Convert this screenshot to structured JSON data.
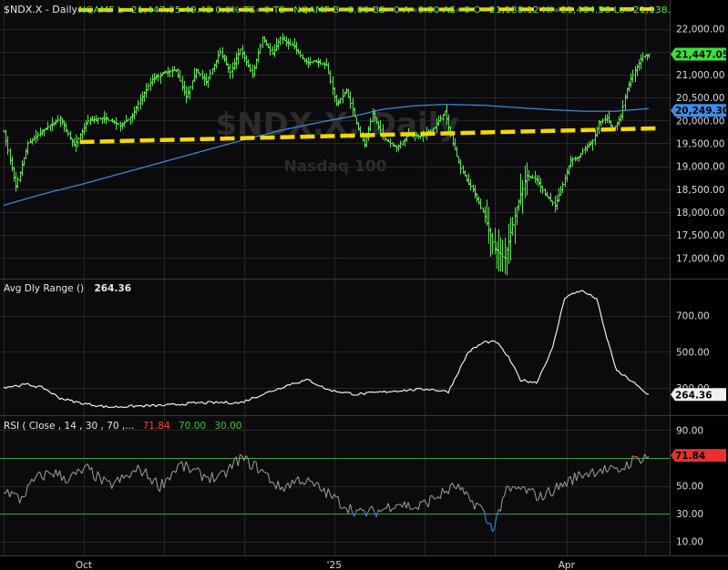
{
  "colors": {
    "background": "#000000",
    "panel_bg": "#0b0b0d",
    "grid": "#262628",
    "divider": "#3a3a3c",
    "bar_up": "#5de84a",
    "ma_line": "#3d8ee8",
    "trendline": "#f5d800",
    "range_line": "#ffffff",
    "rsi_line": "#a0a0a0",
    "rsi_low": "#3d8ee8",
    "rsi_high": "#ff5544",
    "rsi_level": "#36a636",
    "axis_text": "#dcdcdc",
    "price_badge": "#3de03a",
    "ma_badge": "#3d8ee8",
    "range_badge": "#f0f0f0",
    "rsi_badge": "#e83030",
    "watermark": "#3c3c3e"
  },
  "price_panel": {
    "header": "$NDX.X - Daily",
    "header_quote": "NQAMF L=21,447.05 49.43 0.0% TS=0 TS=NQAMF B=0.00 BS=0 A=0.00 AS=0 O=21,138.12 Hi=21,464.56 Lo=21,138.",
    "watermark_symbol": "$NDX.X, Daily",
    "watermark_name": "Nasdaq 100",
    "last_price_label": "21,447.05",
    "ma_label": "20,249.30"
  },
  "range_panel": {
    "title": "Avg Dly Range ()",
    "value": "264.36"
  },
  "rsi_panel": {
    "title": "RSI ( Close , 14 , 30 , 70 ,...",
    "val1": "71.84",
    "val2": "70.00",
    "val3": "30.00",
    "badge": "71.84"
  },
  "chart_data": [
    {
      "type": "bar",
      "subtype": "ohlc",
      "name": "$NDX.X - Daily",
      "y_ticks": [
        17000,
        17500,
        18000,
        18500,
        19000,
        19500,
        20000,
        20500,
        21000,
        21500,
        22000
      ],
      "y_tick_labels": [
        "17,000.00",
        "17,500.00",
        "18,000.00",
        "18,500.00",
        "19,000.00",
        "19,500.00",
        "20,000.00",
        "20,500.00",
        "21,000.00",
        "21,500.00",
        "22,000.00"
      ],
      "ylim": [
        16550,
        22350
      ],
      "x_tick_labels": [
        "Oct",
        "'25",
        "Apr"
      ],
      "close_anchors": [
        [
          0,
          19750
        ],
        [
          6,
          18550
        ],
        [
          12,
          19500
        ],
        [
          20,
          19800
        ],
        [
          28,
          20050
        ],
        [
          35,
          19450
        ],
        [
          42,
          20000
        ],
        [
          50,
          20050
        ],
        [
          58,
          19900
        ],
        [
          64,
          20100
        ],
        [
          68,
          20450
        ],
        [
          74,
          20900
        ],
        [
          80,
          21050
        ],
        [
          86,
          21100
        ],
        [
          91,
          20500
        ],
        [
          96,
          21100
        ],
        [
          101,
          20850
        ],
        [
          108,
          21500
        ],
        [
          113,
          21050
        ],
        [
          118,
          21550
        ],
        [
          124,
          21000
        ],
        [
          129,
          21800
        ],
        [
          134,
          21450
        ],
        [
          138,
          21800
        ],
        [
          145,
          21600
        ],
        [
          150,
          21300
        ],
        [
          152,
          21250
        ],
        [
          155,
          21300
        ],
        [
          161,
          21200
        ],
        [
          166,
          20350
        ],
        [
          171,
          20650
        ],
        [
          176,
          19950
        ],
        [
          180,
          19450
        ],
        [
          184,
          20150
        ],
        [
          190,
          19600
        ],
        [
          196,
          19400
        ],
        [
          202,
          19700
        ],
        [
          208,
          19650
        ],
        [
          215,
          19850
        ],
        [
          220,
          20200
        ],
        [
          224,
          19500
        ],
        [
          228,
          18950
        ],
        [
          235,
          18400
        ],
        [
          240,
          17900
        ],
        [
          245,
          17200
        ],
        [
          250,
          17000
        ],
        [
          256,
          18100
        ],
        [
          261,
          18800
        ],
        [
          266,
          18700
        ],
        [
          270,
          18400
        ],
        [
          275,
          18150
        ],
        [
          279,
          18600
        ],
        [
          283,
          19150
        ],
        [
          287,
          19200
        ],
        [
          290,
          19400
        ],
        [
          294,
          19550
        ],
        [
          297,
          19950
        ],
        [
          301,
          20050
        ],
        [
          304,
          19800
        ],
        [
          308,
          20100
        ],
        [
          311,
          20700
        ],
        [
          315,
          21100
        ],
        [
          319,
          21400
        ],
        [
          322,
          21447
        ]
      ],
      "ma_anchors": [
        [
          0,
          18150
        ],
        [
          20,
          18400
        ],
        [
          40,
          18620
        ],
        [
          60,
          18860
        ],
        [
          80,
          19100
        ],
        [
          100,
          19340
        ],
        [
          120,
          19580
        ],
        [
          140,
          19800
        ],
        [
          160,
          19980
        ],
        [
          175,
          20100
        ],
        [
          190,
          20250
        ],
        [
          205,
          20320
        ],
        [
          220,
          20350
        ],
        [
          240,
          20330
        ],
        [
          260,
          20270
        ],
        [
          275,
          20230
        ],
        [
          290,
          20200
        ],
        [
          305,
          20200
        ],
        [
          322,
          20260
        ]
      ],
      "trendline": [
        [
          38,
          19530
        ],
        [
          328,
          19830
        ]
      ]
    },
    {
      "type": "line",
      "name": "Avg Dly Range ()",
      "y_ticks": [
        300,
        500,
        700
      ],
      "y_tick_labels": [
        "300.00",
        "500.00",
        "700.00"
      ],
      "ylim": [
        150,
        900
      ],
      "anchors": [
        [
          0,
          305
        ],
        [
          12,
          320
        ],
        [
          20,
          300
        ],
        [
          28,
          245
        ],
        [
          38,
          218
        ],
        [
          52,
          195
        ],
        [
          66,
          200
        ],
        [
          82,
          205
        ],
        [
          96,
          218
        ],
        [
          110,
          220
        ],
        [
          118,
          218
        ],
        [
          128,
          260
        ],
        [
          144,
          325
        ],
        [
          152,
          345
        ],
        [
          162,
          290
        ],
        [
          176,
          265
        ],
        [
          196,
          285
        ],
        [
          212,
          295
        ],
        [
          222,
          280
        ],
        [
          232,
          500
        ],
        [
          240,
          555
        ],
        [
          246,
          555
        ],
        [
          252,
          470
        ],
        [
          258,
          345
        ],
        [
          266,
          330
        ],
        [
          274,
          520
        ],
        [
          280,
          800
        ],
        [
          288,
          840
        ],
        [
          296,
          795
        ],
        [
          300,
          620
        ],
        [
          306,
          395
        ],
        [
          314,
          335
        ],
        [
          320,
          275
        ],
        [
          322,
          264
        ]
      ]
    },
    {
      "type": "line",
      "name": "RSI ( Close , 14 , 30 , 70 ,...",
      "y_ticks": [
        10,
        30,
        50,
        70,
        90
      ],
      "y_tick_labels": [
        "10.00",
        "30.00",
        "50.00",
        "70.00",
        "90.00"
      ],
      "ylim": [
        0,
        100
      ],
      "levels": [
        70,
        30
      ],
      "anchors": [
        [
          0,
          48
        ],
        [
          8,
          40
        ],
        [
          16,
          55
        ],
        [
          24,
          60
        ],
        [
          32,
          55
        ],
        [
          42,
          62
        ],
        [
          52,
          50
        ],
        [
          60,
          55
        ],
        [
          68,
          62
        ],
        [
          78,
          50
        ],
        [
          88,
          65
        ],
        [
          98,
          58
        ],
        [
          108,
          55
        ],
        [
          118,
          70
        ],
        [
          128,
          62
        ],
        [
          138,
          48
        ],
        [
          148,
          55
        ],
        [
          158,
          48
        ],
        [
          168,
          38
        ],
        [
          178,
          30
        ],
        [
          188,
          32
        ],
        [
          196,
          38
        ],
        [
          206,
          34
        ],
        [
          216,
          42
        ],
        [
          226,
          50
        ],
        [
          232,
          40
        ],
        [
          238,
          35
        ],
        [
          242,
          22
        ],
        [
          245,
          21
        ],
        [
          250,
          45
        ],
        [
          258,
          48
        ],
        [
          268,
          42
        ],
        [
          278,
          50
        ],
        [
          288,
          58
        ],
        [
          298,
          62
        ],
        [
          306,
          60
        ],
        [
          314,
          68
        ],
        [
          322,
          71.84
        ]
      ]
    }
  ]
}
